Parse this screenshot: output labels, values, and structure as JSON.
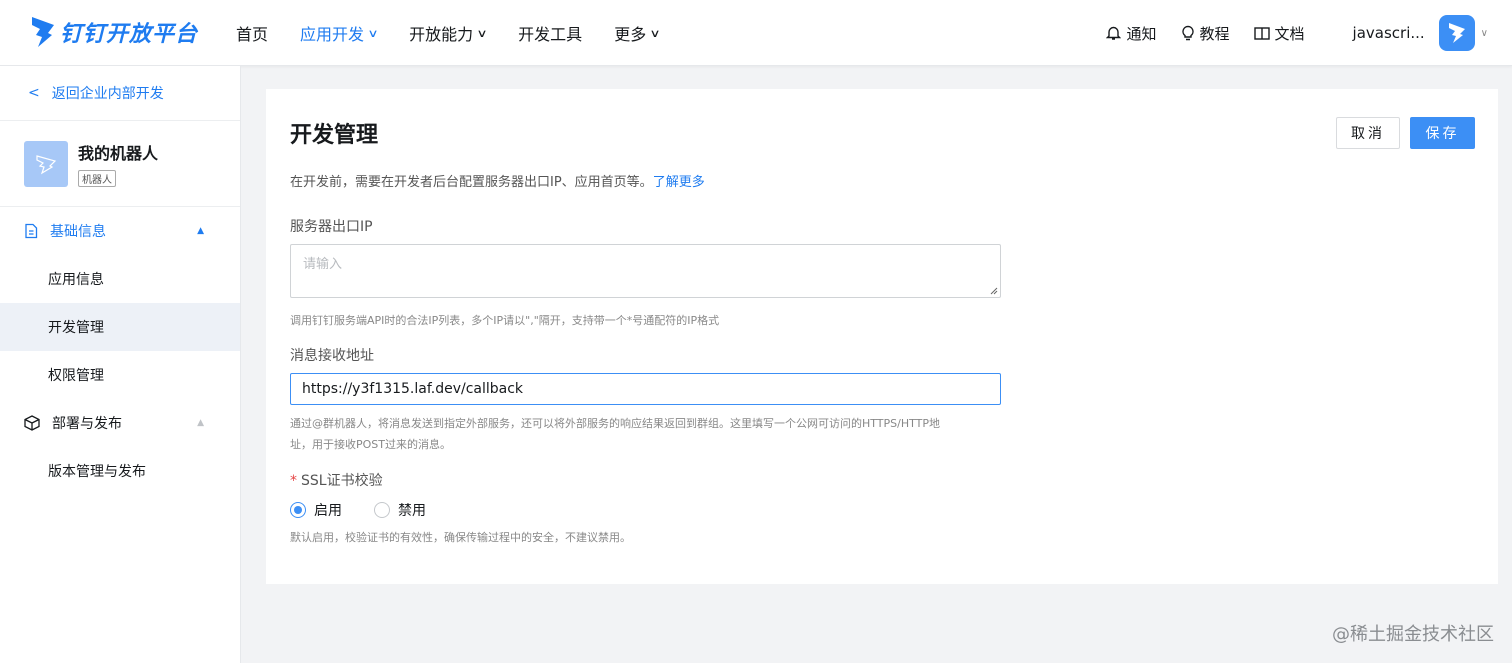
{
  "brand": {
    "logo_text": "钉钉开放平台",
    "color": "#1f7cf0"
  },
  "nav": {
    "items": [
      {
        "label": "首页",
        "dropdown": false
      },
      {
        "label": "应用开发",
        "dropdown": true
      },
      {
        "label": "开放能力",
        "dropdown": true
      },
      {
        "label": "开发工具",
        "dropdown": false
      },
      {
        "label": "更多",
        "dropdown": true
      }
    ],
    "active_index": 1,
    "right": {
      "notify": "通知",
      "tutorial": "教程",
      "docs": "文档",
      "user": "javascri..."
    }
  },
  "sidebar": {
    "back": "返回企业内部开发",
    "app_name": "我的机器人",
    "app_tag": "机器人",
    "groups": [
      {
        "label": "基础信息",
        "icon": "document-icon",
        "expanded": true,
        "items": [
          "应用信息",
          "开发管理",
          "权限管理"
        ]
      },
      {
        "label": "部署与发布",
        "icon": "cube-icon",
        "expanded": true,
        "items": [
          "版本管理与发布"
        ]
      }
    ],
    "selected_item": "开发管理"
  },
  "main": {
    "title": "开发管理",
    "cancel": "取消",
    "save": "保存",
    "desc": "在开发前，需要在开发者后台配置服务器出口IP、应用首页等。",
    "desc_link": "了解更多",
    "ip_label": "服务器出口IP",
    "ip_placeholder": "请输入",
    "ip_hint": "调用钉钉服务端API时的合法IP列表，多个IP请以\",\"隔开，支持带一个*号通配符的IP格式",
    "msg_label": "消息接收地址",
    "msg_value": "https://y3f1315.laf.dev/callback",
    "msg_hint_1": "通过@群机器人，将消息发送到指定外部服务，还可以将外部服务的响应结果返回到群组。这里填写一个公网可访问的HTTPS/HTTP地",
    "msg_hint_2": "址，用于接收POST过来的消息。",
    "ssl_required": "*",
    "ssl_label": "SSL证书校验",
    "ssl_options": [
      "启用",
      "禁用"
    ],
    "ssl_selected": "启用",
    "ssl_hint": "默认启用，校验证书的有效性，确保传输过程中的安全，不建议禁用。"
  },
  "watermark": "@稀土掘金技术社区"
}
